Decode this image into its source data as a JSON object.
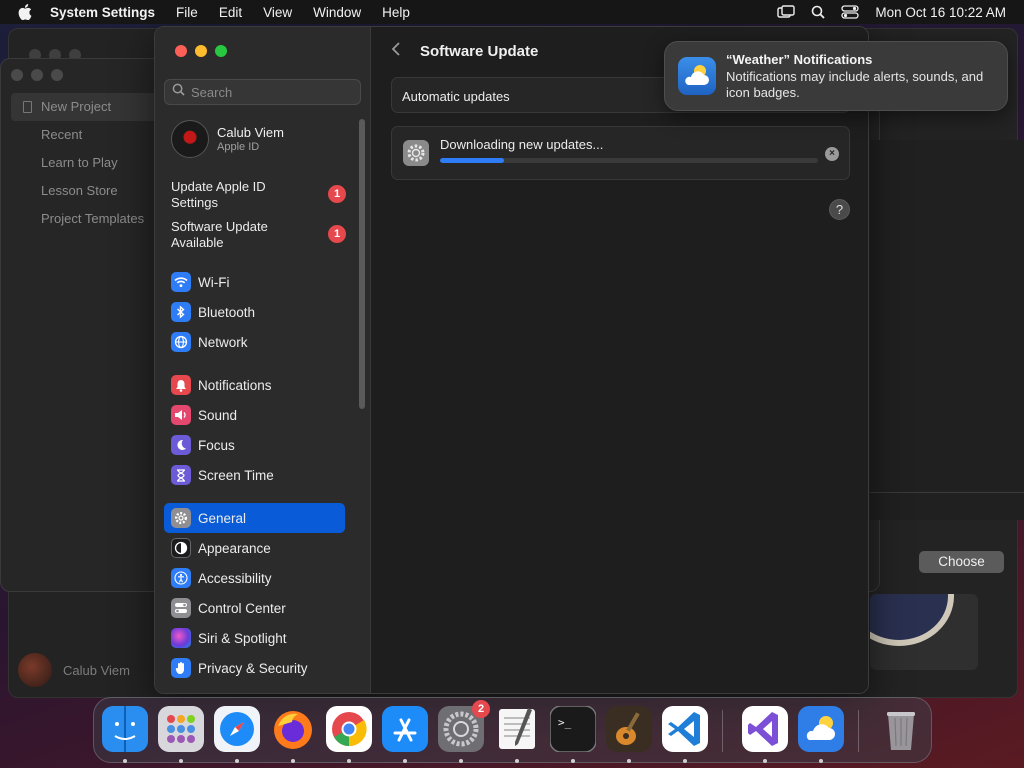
{
  "menubar": {
    "app_name": "System Settings",
    "menus": [
      "File",
      "Edit",
      "View",
      "Window",
      "Help"
    ],
    "clock": "Mon Oct 16  10:22 AM"
  },
  "background_app": {
    "sidebar": [
      "New Project",
      "Recent",
      "Learn to Play",
      "Lesson Store",
      "Project Templates"
    ],
    "user_name": "Calub Viem",
    "choose_label": "Choose"
  },
  "settings": {
    "search_placeholder": "Search",
    "profile": {
      "name": "Calub Viem",
      "subtitle": "Apple ID"
    },
    "notices": [
      {
        "label": "Update Apple ID Settings",
        "badge": "1"
      },
      {
        "label": "Software Update Available",
        "badge": "1"
      }
    ],
    "nav_groups": [
      [
        {
          "label": "Wi-Fi",
          "icon": "wifi-icon",
          "color": "#2f7df6"
        },
        {
          "label": "Bluetooth",
          "icon": "bluetooth-icon",
          "color": "#2f7df6"
        },
        {
          "label": "Network",
          "icon": "globe-icon",
          "color": "#2f7df6"
        }
      ],
      [
        {
          "label": "Notifications",
          "icon": "bell-icon",
          "color": "#e5484d"
        },
        {
          "label": "Sound",
          "icon": "speaker-icon",
          "color": "#e5486e"
        },
        {
          "label": "Focus",
          "icon": "moon-icon",
          "color": "#6b5bd6"
        },
        {
          "label": "Screen Time",
          "icon": "hourglass-icon",
          "color": "#6b5bd6"
        }
      ],
      [
        {
          "label": "General",
          "icon": "gear-icon",
          "color": "#8e8e93",
          "active": true
        },
        {
          "label": "Appearance",
          "icon": "appearance-icon",
          "color": "#1c1c1e"
        },
        {
          "label": "Accessibility",
          "icon": "accessibility-icon",
          "color": "#2f7df6"
        },
        {
          "label": "Control Center",
          "icon": "control-center-icon",
          "color": "#8e8e93"
        },
        {
          "label": "Siri & Spotlight",
          "icon": "siri-icon",
          "color": "#b04ae0"
        },
        {
          "label": "Privacy & Security",
          "icon": "hand-icon",
          "color": "#2f7df6"
        }
      ]
    ],
    "page_title": "Software Update",
    "auto_updates_label": "Automatic updates",
    "download_message": "Downloading new updates...",
    "download_progress": 0.17,
    "help_label": "?"
  },
  "notification": {
    "title": "“Weather” Notifications",
    "body": "Notifications may include alerts, sounds, and icon badges."
  },
  "dock": {
    "apps": [
      {
        "name": "finder-icon",
        "color": "#2a8df0"
      },
      {
        "name": "launchpad-icon",
        "color": "#d8d8dc"
      },
      {
        "name": "safari-icon",
        "color": "#f0f4f8"
      },
      {
        "name": "firefox-icon",
        "color": "#ff7a1a"
      },
      {
        "name": "chrome-icon",
        "color": "#ffffff"
      },
      {
        "name": "app-store-icon",
        "color": "#1d8cf8"
      },
      {
        "name": "system-settings-icon",
        "color": "#8a8a8a",
        "badge": "2"
      },
      {
        "name": "textedit-icon",
        "color": "#f6f6f6"
      },
      {
        "name": "terminal-icon",
        "color": "#1a1a1a"
      },
      {
        "name": "garageband-icon",
        "color": "#6e5a3a"
      },
      {
        "name": "vscode-icon",
        "color": "#ffffff"
      },
      {
        "name": "visual-studio-icon",
        "color": "#ffffff"
      },
      {
        "name": "weather-icon",
        "color": "#2f7ee8"
      },
      {
        "name": "trash-icon",
        "color": "#9a9a9a"
      }
    ]
  }
}
